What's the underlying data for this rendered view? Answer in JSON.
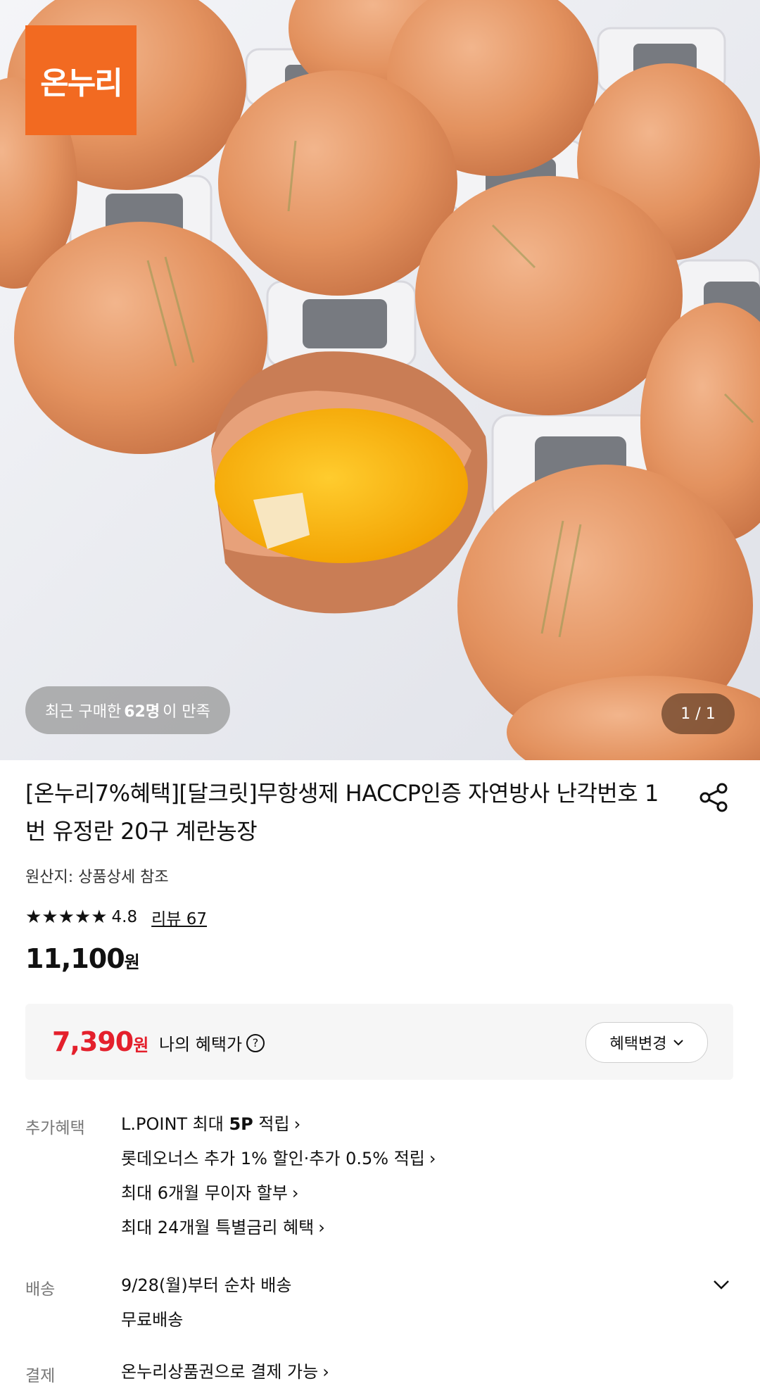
{
  "hero": {
    "logo_text": "온누리",
    "buyers_prefix": "최근 구매한 ",
    "buyers_count": "62명",
    "buyers_suffix": "이 만족",
    "page_indicator": "1 / 1"
  },
  "product": {
    "title": "[온누리7%혜택][달크릿]무항생제 HACCP인증 자연방사 난각번호 1번 유정란 20구 계란농장",
    "origin": "원산지: 상품상세 참조",
    "stars": "★★★★★",
    "rating": "4.8",
    "review_link": "리뷰 67",
    "price": "11,100",
    "currency": "원",
    "benefit_price": "7,390",
    "benefit_currency": "원",
    "benefit_label": "나의 혜택가",
    "change_button": "혜택변경"
  },
  "extra_benefits": {
    "label": "추가혜택",
    "items": [
      {
        "pre": "L.POINT 최대 ",
        "bold": "5P",
        "post": " 적립"
      },
      {
        "text": "롯데오너스 추가 1% 할인·추가 0.5% 적립"
      },
      {
        "text": "최대 6개월 무이자 할부"
      },
      {
        "text": "최대 24개월 특별금리 혜택"
      }
    ]
  },
  "shipping": {
    "label": "배송",
    "line1": "9/28(월)부터 순차 배송",
    "line2": "무료배송"
  },
  "payment": {
    "label": "결제",
    "text": "온누리상품권으로 결제 가능"
  },
  "colors": {
    "brand_orange": "#f26a21",
    "benefit_red": "#e4202c"
  }
}
